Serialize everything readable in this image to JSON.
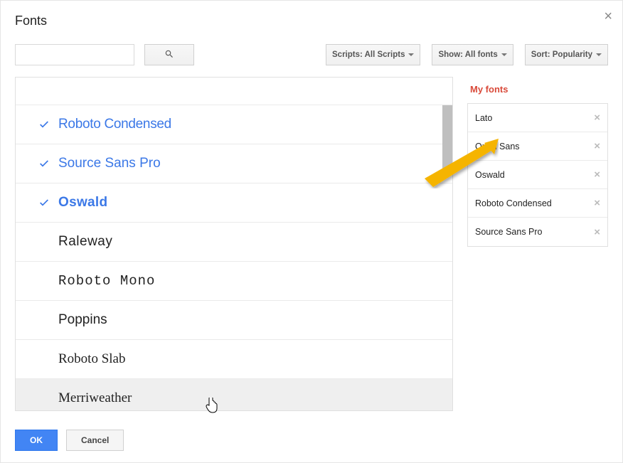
{
  "dialog": {
    "title": "Fonts"
  },
  "toolbar": {
    "scripts_label": "Scripts: All Scripts",
    "show_label": "Show: All fonts",
    "sort_label": "Sort: Popularity"
  },
  "fonts": [
    {
      "name": "Roboto Condensed",
      "selected": true,
      "css": "ff-roboto-cond"
    },
    {
      "name": "Source Sans Pro",
      "selected": true,
      "css": "ff-source-sans"
    },
    {
      "name": "Oswald",
      "selected": true,
      "css": "ff-oswald"
    },
    {
      "name": "Raleway",
      "selected": false,
      "css": "ff-raleway"
    },
    {
      "name": "Roboto Mono",
      "selected": false,
      "css": "ff-roboto-mono"
    },
    {
      "name": "Poppins",
      "selected": false,
      "css": "ff-poppins"
    },
    {
      "name": "Roboto Slab",
      "selected": false,
      "css": "ff-roboto-slab"
    },
    {
      "name": "Merriweather",
      "selected": false,
      "css": "ff-merriweather",
      "hovered": true
    }
  ],
  "side": {
    "title": "My fonts",
    "items": [
      {
        "name": "Lato"
      },
      {
        "name": "Open Sans"
      },
      {
        "name": "Oswald"
      },
      {
        "name": "Roboto Condensed"
      },
      {
        "name": "Source Sans Pro"
      }
    ]
  },
  "footer": {
    "ok": "OK",
    "cancel": "Cancel"
  }
}
